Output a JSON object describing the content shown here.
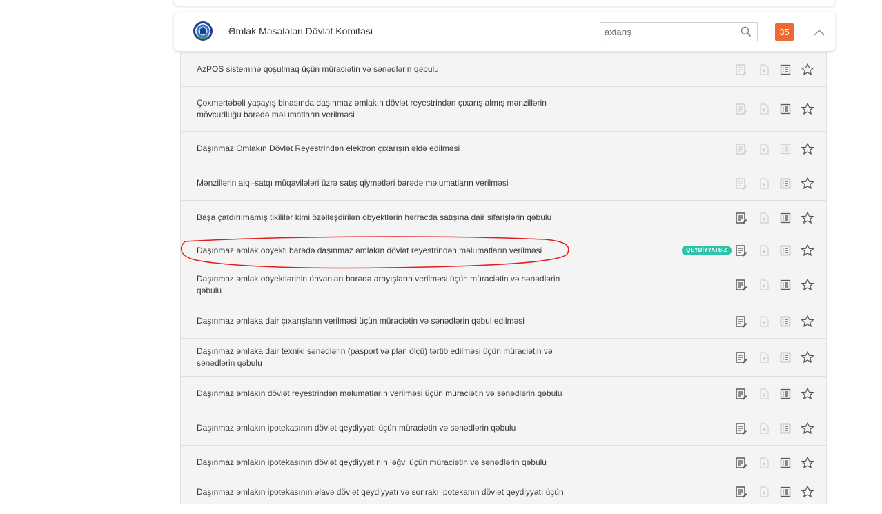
{
  "header": {
    "title": "Əmlak Məsələləri Dövlət Komitəsi",
    "search_placeholder": "axtarış",
    "count": "35"
  },
  "services": [
    {
      "title": "AzPOS sisteminə qoşulmaq üçün müraciətin və sənədlərin qəbulu",
      "apply_enabled": false,
      "doc_enabled": false,
      "info_enabled": true,
      "tag": ""
    },
    {
      "title": "Çoxmərtəbəli yaşayış binasında daşınmaz əmlakın dövlət reyestrindən çıxarış almış mənzillərin mövcudluğu barədə məlumatların verilməsi",
      "apply_enabled": false,
      "doc_enabled": false,
      "info_enabled": true,
      "tag": ""
    },
    {
      "title": "Daşınmaz Əmlakın Dövlət Reyestrindən elektron çıxarışın əldə edilməsi",
      "apply_enabled": false,
      "doc_enabled": false,
      "info_enabled": false,
      "tag": ""
    },
    {
      "title": "Mənzillərin alqı-satqı müqavilələri üzrə satış qiymətləri barədə məlumatların verilməsi",
      "apply_enabled": false,
      "doc_enabled": false,
      "info_enabled": true,
      "tag": ""
    },
    {
      "title": "Başa çatdırılmamış tikililər kimi özəlləşdirilən obyektlərin hərracda satışına dair sifarişlərin qəbulu",
      "apply_enabled": true,
      "doc_enabled": false,
      "info_enabled": true,
      "tag": ""
    },
    {
      "title": "Daşınmaz əmlak obyekti barədə daşınmaz əmlakın dövlət reyestrindən məlumatların verilməsi",
      "apply_enabled": true,
      "doc_enabled": false,
      "info_enabled": true,
      "tag": "QEYDİYYATSIZ"
    },
    {
      "title": "Daşınmaz əmlak obyektlərinin ünvanları barədə arayışların verilməsi üçün müraciətin və sənədlərin qəbulu",
      "apply_enabled": true,
      "doc_enabled": false,
      "info_enabled": true,
      "tag": ""
    },
    {
      "title": "Daşınmaz əmlaka dair çıxarışların verilməsi üçün müraciətin və sənədlərin qəbul edilməsi",
      "apply_enabled": true,
      "doc_enabled": false,
      "info_enabled": true,
      "tag": ""
    },
    {
      "title": "Daşınmaz əmlaka dair texniki sənədlərin (pasport və plan ölçü) tərtib edilməsi üçün müraciətin və sənədlərin qəbulu",
      "apply_enabled": true,
      "doc_enabled": false,
      "info_enabled": true,
      "tag": ""
    },
    {
      "title": "Daşınmaz əmlakın dövlət reyestrindən məlumatların verilməsi üçün müraciətin və sənədlərin qəbulu",
      "apply_enabled": true,
      "doc_enabled": false,
      "info_enabled": true,
      "tag": ""
    },
    {
      "title": "Daşınmaz əmlakın ipotekasının dövlət qeydiyyatı üçün müraciətin və sənədlərin qəbulu",
      "apply_enabled": true,
      "doc_enabled": false,
      "info_enabled": true,
      "tag": ""
    },
    {
      "title": "Daşınmaz əmlakın ipotekasının dövlət qeydiyyatının ləğvi üçün müraciətin və sənədlərin qəbulu",
      "apply_enabled": true,
      "doc_enabled": false,
      "info_enabled": true,
      "tag": ""
    },
    {
      "title": "Daşınmaz əmlakın ipotekasının əlavə dövlət qeydiyyatı və sonrakı ipotekanın dövlət qeydiyyatı üçün",
      "apply_enabled": true,
      "doc_enabled": false,
      "info_enabled": true,
      "tag": ""
    }
  ],
  "colors": {
    "active_icon": "#5a5a5a",
    "disabled_icon": "#cfcfcf",
    "badge": "#ee6a35",
    "tag": "#2bc4a8",
    "annotation": "#e41c1c"
  }
}
